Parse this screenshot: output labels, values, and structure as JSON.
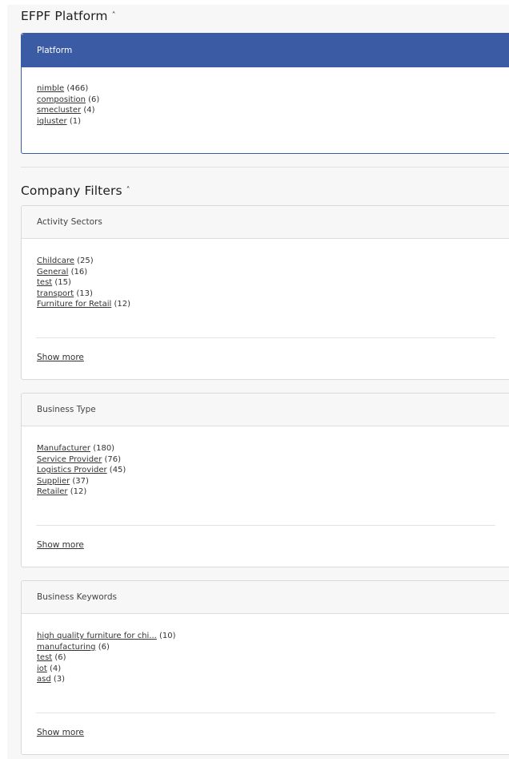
{
  "platform_section": {
    "title": "EFPF Platform",
    "caret": "˄",
    "card_header": "Platform",
    "items": [
      {
        "label": "nimble",
        "count": "(466)"
      },
      {
        "label": "composition",
        "count": "(6)"
      },
      {
        "label": "smecluster",
        "count": "(4)"
      },
      {
        "label": "iqluster",
        "count": "(1)"
      }
    ]
  },
  "company_filters": {
    "title": "Company Filters",
    "caret": "˄",
    "activity_sectors": {
      "header": "Activity Sectors",
      "items": [
        {
          "label": "Childcare",
          "count": "(25)"
        },
        {
          "label": "General",
          "count": "(16)"
        },
        {
          "label": "test",
          "count": "(15)"
        },
        {
          "label": "transport",
          "count": "(13)"
        },
        {
          "label": "Furniture for Retail",
          "count": "(12)"
        }
      ],
      "show_more": "Show more"
    },
    "business_type": {
      "header": "Business Type",
      "items": [
        {
          "label": "Manufacturer",
          "count": "(180)"
        },
        {
          "label": "Service Provider",
          "count": "(76)"
        },
        {
          "label": "Logistics Provider",
          "count": "(45)"
        },
        {
          "label": "Supplier",
          "count": "(37)"
        },
        {
          "label": "Retailer",
          "count": "(12)"
        }
      ],
      "show_more": "Show more"
    },
    "business_keywords": {
      "header": "Business Keywords",
      "items": [
        {
          "label": "high quality furniture for chi...",
          "count": "(10)"
        },
        {
          "label": "manufacturing",
          "count": "(6)"
        },
        {
          "label": "test",
          "count": "(6)"
        },
        {
          "label": "iot",
          "count": "(4)"
        },
        {
          "label": "asd",
          "count": "(3)"
        }
      ],
      "show_more": "Show more"
    }
  },
  "colors": {
    "primary_header": "#3b5ba5",
    "page_background": "#f7f7f7"
  }
}
